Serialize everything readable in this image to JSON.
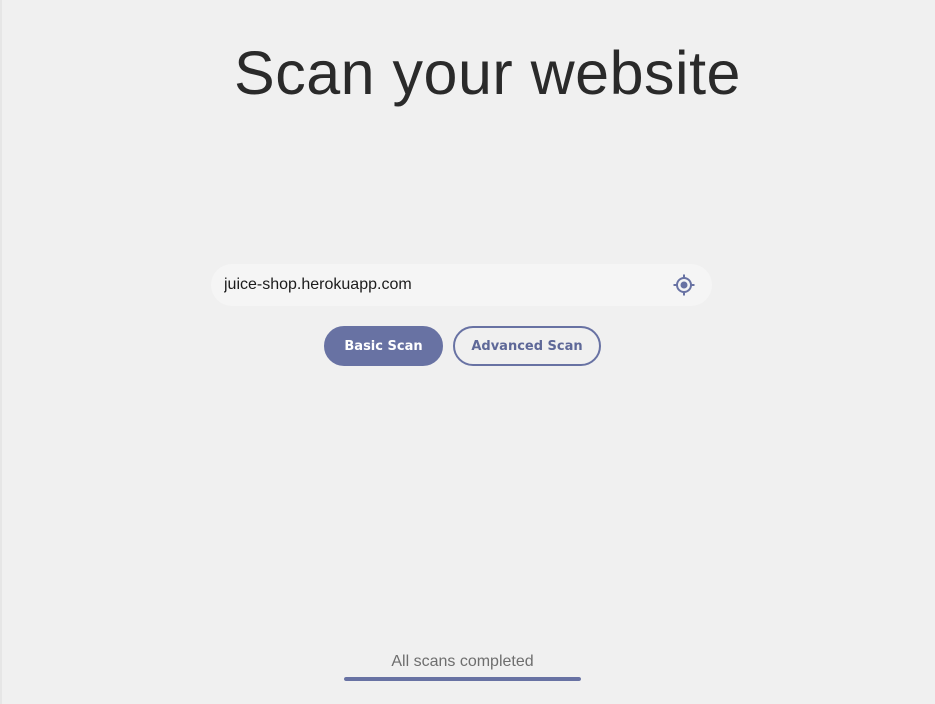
{
  "page": {
    "title": "Scan your website"
  },
  "search": {
    "value": "juice-shop.herokuapp.com",
    "locate_icon": "crosshair-target-icon"
  },
  "actions": {
    "basic_scan_label": "Basic Scan",
    "advanced_scan_label": "Advanced Scan"
  },
  "status": {
    "text": "All scans completed",
    "progress": 1.0
  },
  "colors": {
    "background": "#f0f0f0",
    "accent": "#6872a3",
    "title": "#2a2a2a",
    "input_background": "#f5f5f5"
  }
}
